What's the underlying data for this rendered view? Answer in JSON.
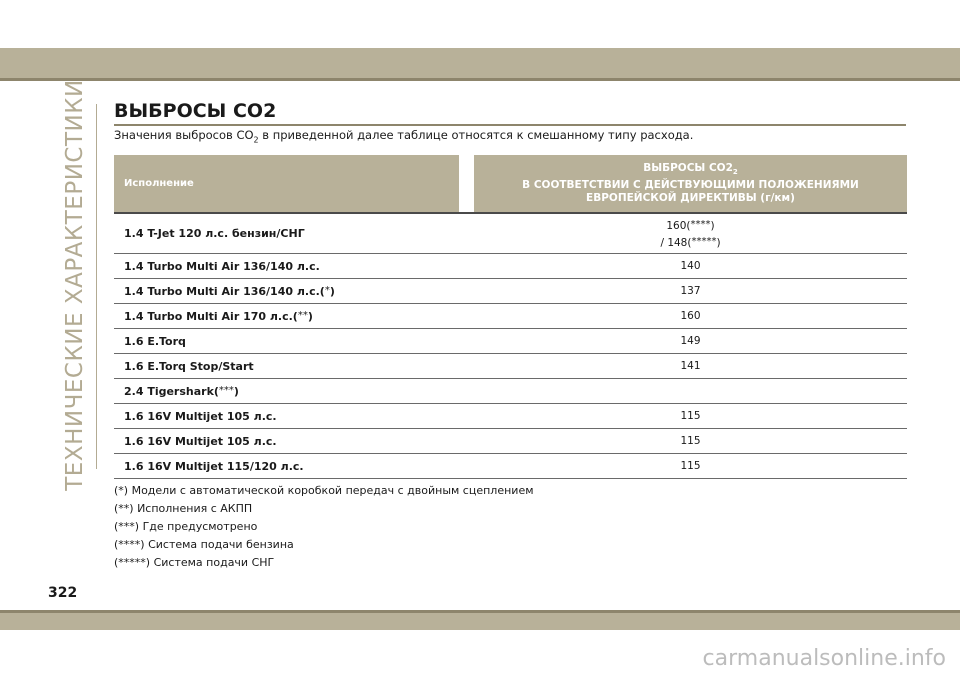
{
  "page": {
    "side_title": "ТЕХНИЧЕСКИЕ ХАРАКТЕРИСТИКИ",
    "title": "ВЫБРОСЫ СО2",
    "intro_part1": "Значения выбросов СО",
    "intro_sub": "2",
    "intro_part2": " в приведенной далее таблице относятся к смешанному типу расхода.",
    "page_number": "322",
    "watermark": "carmanualsonline.info"
  },
  "table": {
    "col1_header": "Исполнение",
    "col2_header_line1": "ВЫБРОСЫ СО2",
    "col2_header_sub": "2",
    "col2_header_line2": "В СООТВЕТСТВИИ С ДЕЙСТВУЮЩИМИ ПОЛОЖЕНИЯМИ",
    "col2_header_line3": "ЕВРОПЕЙСКОЙ ДИРЕКТИВЫ (г/км)",
    "rows": [
      {
        "engine": "1.4 T-Jet 120 л.с. бензин/СНГ",
        "engine_mark": "",
        "value_line1": "160(",
        "value_mark1": "****",
        "value_line1_end": ")",
        "value_line2": "/ 148(",
        "value_mark2": "*****",
        "value_line2_end": ")"
      },
      {
        "engine": "1.4 Turbo Multi Air 136/140 л.с.",
        "engine_mark": "",
        "value": "140"
      },
      {
        "engine": "1.4 Turbo Multi Air 136/140 л.с.(",
        "engine_mark": "*",
        "engine_end": ")",
        "value": "137"
      },
      {
        "engine": "1.4 Turbo Multi Air 170 л.с.(",
        "engine_mark": "**",
        "engine_end": ")",
        "value": "160"
      },
      {
        "engine": "1.6 E.Torq",
        "engine_mark": "",
        "value": "149"
      },
      {
        "engine": "1.6 E.Torq Stop/Start",
        "engine_mark": "",
        "value": "141"
      },
      {
        "engine": "2.4 Tigershark(",
        "engine_mark": "***",
        "engine_end": ")",
        "value": ""
      },
      {
        "engine": "1.6 16V Multijet 105 л.с.",
        "engine_mark": "",
        "value": "115"
      },
      {
        "engine": "1.6 16V Multijet 105 л.с.",
        "engine_mark": "",
        "value": "115"
      },
      {
        "engine": "1.6 16V Multijet 115/120 л.с.",
        "engine_mark": "",
        "value": "115"
      }
    ]
  },
  "notes": [
    "(*) Модели с автоматической коробкой передач с двойным сцеплением",
    "(**) Исполнения с АКПП",
    "(***) Где предусмотрено",
    "(****) Система подачи бензина",
    "(*****) Система подачи СНГ"
  ],
  "colors": {
    "band": "#b8b199",
    "band_dark": "#8d856c",
    "side_text": "#b3ab93",
    "header_text": "#ffffff"
  }
}
